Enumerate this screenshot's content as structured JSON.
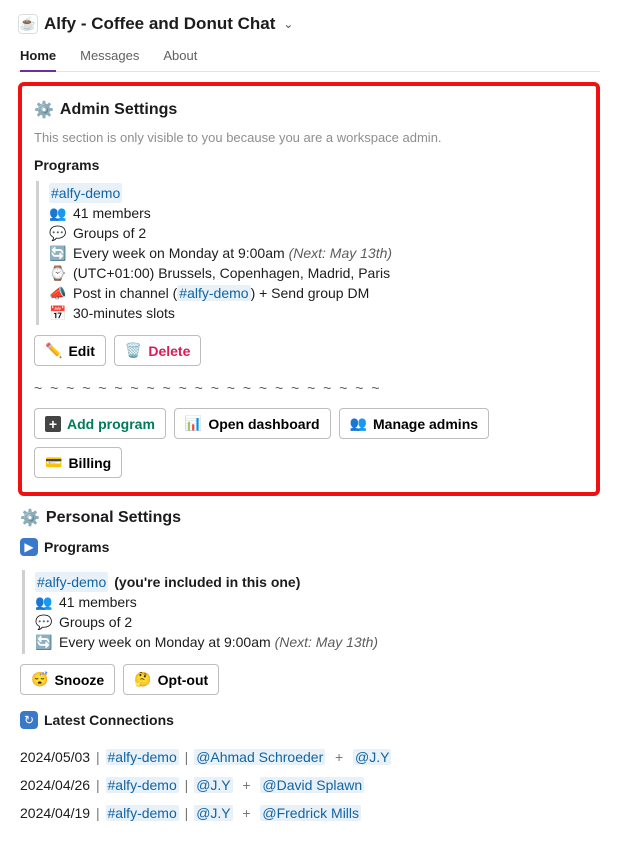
{
  "header": {
    "title": "Alfy - Coffee and Donut Chat"
  },
  "tabs": [
    {
      "label": "Home",
      "active": true
    },
    {
      "label": "Messages",
      "active": false
    },
    {
      "label": "About",
      "active": false
    }
  ],
  "admin": {
    "title": "Admin Settings",
    "subtitle": "This section is only visible to you because you are a workspace admin.",
    "programs_heading": "Programs",
    "program": {
      "channel": "#alfy-demo",
      "members": "41 members",
      "groups": "Groups of 2",
      "schedule_pre": "Every week on Monday at 9:00am ",
      "schedule_next": "(Next: May 13th)",
      "timezone": "(UTC+01:00) Brussels, Copenhagen, Madrid, Paris",
      "post_pre": "Post in channel (",
      "post_channel": "#alfy-demo",
      "post_post": ") + Send group DM",
      "slots": "30-minutes slots"
    },
    "buttons": {
      "edit": "Edit",
      "delete": "Delete",
      "add": "Add program",
      "dashboard": "Open dashboard",
      "manage": "Manage admins",
      "billing": "Billing"
    },
    "divider": "~ ~ ~ ~ ~ ~ ~ ~ ~ ~ ~ ~ ~ ~ ~ ~ ~ ~ ~ ~ ~ ~"
  },
  "personal": {
    "title": "Personal Settings",
    "programs_heading": "Programs",
    "program": {
      "channel": "#alfy-demo",
      "included": " (you're included in this one)",
      "members": "41 members",
      "groups": "Groups of 2",
      "schedule_pre": "Every week on Monday at 9:00am ",
      "schedule_next": "(Next: May 13th)"
    },
    "buttons": {
      "snooze": "Snooze",
      "optout": "Opt-out"
    },
    "latest_heading": "Latest Connections",
    "connections": [
      {
        "date": "2024/05/03",
        "channel": "#alfy-demo",
        "u1": "@Ahmad Schroeder",
        "join": "+",
        "u2": "@J.Y"
      },
      {
        "date": "2024/04/26",
        "channel": "#alfy-demo",
        "u1": "@J.Y",
        "join": "+",
        "u2": "@David Splawn"
      },
      {
        "date": "2024/04/19",
        "channel": "#alfy-demo",
        "u1": "@J.Y",
        "join": "+",
        "u2": "@Fredrick Mills"
      }
    ]
  }
}
